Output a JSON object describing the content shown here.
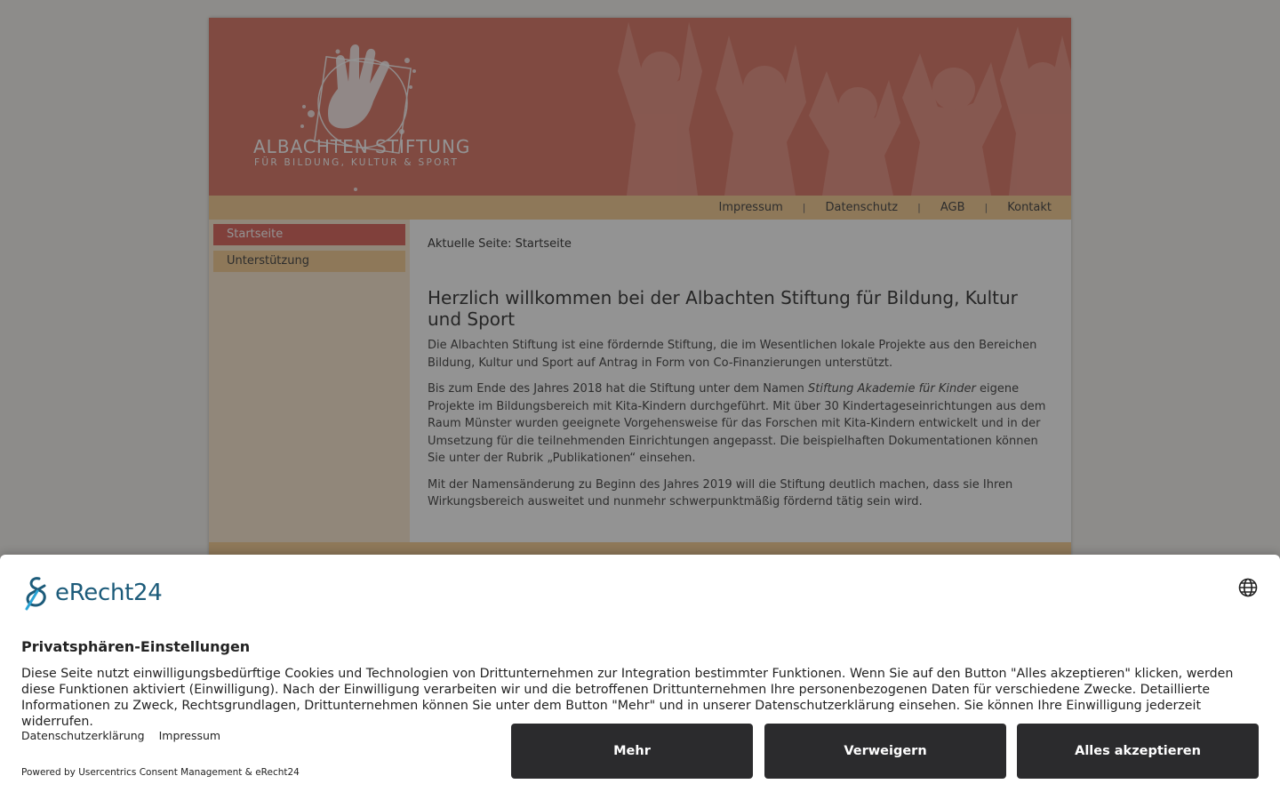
{
  "site": {
    "logo_title": "ALBACHTEN STIFTUNG",
    "logo_subtitle": "FÜR BILDUNG, KULTUR & SPORT"
  },
  "top_nav": {
    "items": [
      "Impressum",
      "Datenschutz",
      "AGB",
      "Kontakt"
    ],
    "separator": "|"
  },
  "sidebar": {
    "items": [
      {
        "label": "Startseite",
        "active": true
      },
      {
        "label": "Unterstützung",
        "active": false
      }
    ]
  },
  "content": {
    "breadcrumb": "Aktuelle Seite: Startseite",
    "heading": "Herzlich willkommen bei der Albachten Stiftung für Bildung, Kultur und Sport",
    "para1": "Die Albachten Stiftung ist eine fördernde Stiftung, die im Wesentlichen lokale Projekte aus den Bereichen Bildung, Kultur und Sport auf Antrag in Form von Co-Finanzierungen unterstützt.",
    "para2_before": "Bis zum Ende des Jahres 2018 hat die Stiftung unter dem Namen ",
    "para2_italic": "Stiftung Akademie für Kinder",
    "para2_after": " eigene Projekte im Bildungsbereich mit Kita-Kindern durchgeführt. Mit über 30 Kindertageseinrichtungen aus dem Raum Münster wurden geeignete Vorgehensweise für das Forschen mit Kita-Kindern entwickelt und in der Umsetzung für die teilnehmenden Einrichtungen angepasst. Die beispielhaften Dokumentationen können Sie unter der Rubrik „Publikationen“ einsehen.",
    "para3": "Mit der Namensänderung zu Beginn des Jahres 2019 will die Stiftung deutlich machen, dass sie Ihren Wirkungsbereich ausweitet und nunmehr schwerpunktmäßig fördernd tätig sein wird."
  },
  "consent": {
    "brand": "eRecht24",
    "title": "Privatsphären-Einstellungen",
    "text": "Diese Seite nutzt einwilligungsbedürftige Cookies und Technologien von Drittunternehmen zur Integration bestimmter Funktionen. Wenn Sie auf den Button \"Alles akzeptieren\" klicken, werden diese Funktionen aktiviert (Einwilligung). Nach der Einwilligung verarbeiten wir und die betroffenen Drittunternehmen Ihre personenbezogenen Daten für verschiedene Zwecke. Detaillierte Informationen zu Zweck, Rechtsgrundlagen, Drittunternehmen können Sie unter dem Button \"Mehr\" und in unserer Datenschutzerklärung einsehen. Sie können Ihre Einwilligung jederzeit widerrufen.",
    "link_privacy": "Datenschutzerklärung",
    "link_imprint": "Impressum",
    "powered_by": "Powered by Usercentrics Consent Management & eRecht24",
    "btn_more": "Mehr",
    "btn_deny": "Verweigern",
    "btn_accept": "Alles akzeptieren",
    "icon": "globe-icon"
  },
  "colors": {
    "header_bg": "#d96c5b",
    "nav_bg": "#f5c98a",
    "sidebar_bg": "#fbe7cd",
    "active_item": "#d9584f",
    "button_dark": "#2b2b2d",
    "brand_blue": "#1c5b7a"
  }
}
